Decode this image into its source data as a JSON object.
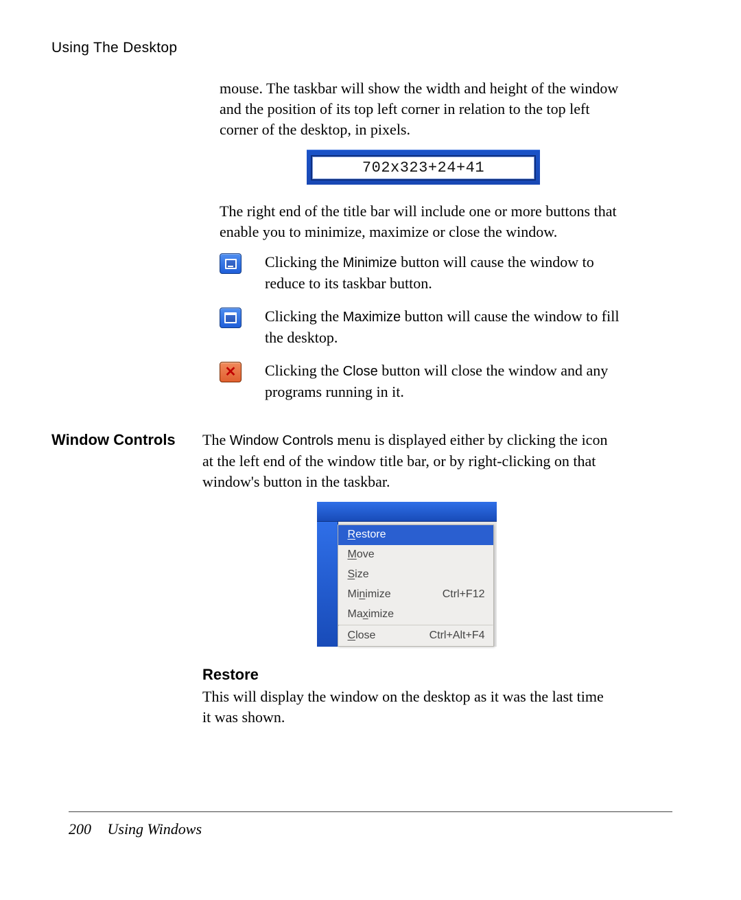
{
  "header": {
    "running": "Using The Desktop"
  },
  "intro": {
    "para1": "mouse. The taskbar will show the width and height of the window and the position of its top left corner in relation to the top left corner of the desktop, in pixels.",
    "coords": "702x323+24+41",
    "para2": "The right end of the title bar will include one or more buttons that enable you to minimize, maximize or close the window."
  },
  "buttons": {
    "minimize": {
      "pre": "Clicking the ",
      "kw": "Minimize",
      "post": "  button will cause the window to reduce to its taskbar button."
    },
    "maximize": {
      "pre": "Clicking the ",
      "kw": "Maximize",
      "post": "  button will cause the window to fill the desktop."
    },
    "close": {
      "pre": "Clicking the ",
      "kw": "Close",
      "post": " button will close the window and any programs running in it."
    }
  },
  "section": {
    "heading": "Window Controls",
    "para_pre": "The ",
    "para_kw": "Window Controls",
    "para_post": "   menu is displayed either by clicking the icon at the left end of the window title bar, or by right-clicking on that window's button in the taskbar."
  },
  "menu": {
    "items": [
      {
        "label_pre": "",
        "mnemonic": "R",
        "label_post": "estore",
        "accel": "",
        "selected": true
      },
      {
        "label_pre": "",
        "mnemonic": "M",
        "label_post": "ove",
        "accel": "",
        "selected": false
      },
      {
        "label_pre": "",
        "mnemonic": "S",
        "label_post": "ize",
        "accel": "",
        "selected": false
      },
      {
        "label_pre": "Mi",
        "mnemonic": "n",
        "label_post": "imize",
        "accel": "Ctrl+F12",
        "selected": false
      },
      {
        "label_pre": "Ma",
        "mnemonic": "x",
        "label_post": "imize",
        "accel": "",
        "selected": false
      },
      {
        "label_pre": "",
        "mnemonic": "C",
        "label_post": "lose",
        "accel": "Ctrl+Alt+F4",
        "selected": false
      }
    ]
  },
  "restore": {
    "heading": "Restore",
    "body": "This will display the window on the desktop as it was the last time it was shown."
  },
  "footer": {
    "page_number": "200",
    "section": "Using Windows"
  }
}
